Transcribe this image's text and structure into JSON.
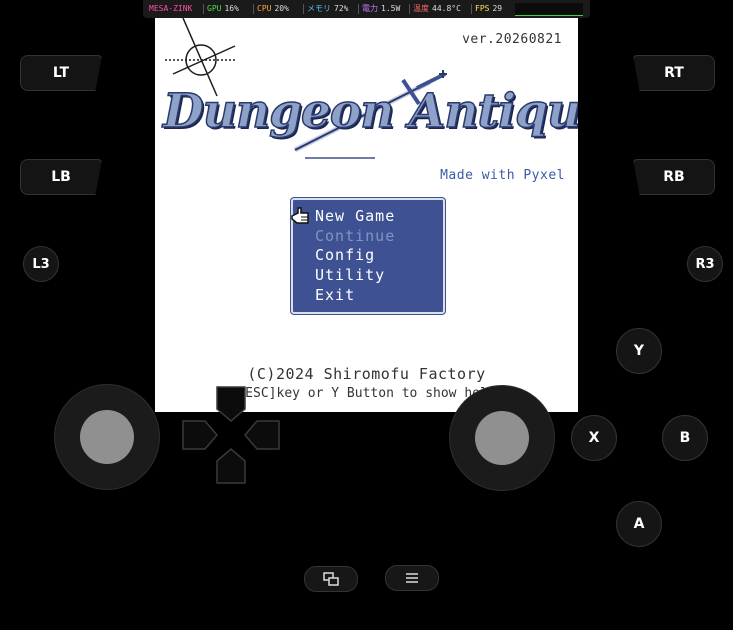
{
  "hud": {
    "renderer": "MESA-ZINK",
    "gpu_label": "GPU",
    "gpu_value": "16%",
    "cpu_label": "CPU",
    "cpu_value": "20%",
    "mem_label": "メモリ",
    "mem_value": "72%",
    "power_label": "電力",
    "power_value": "1.5W",
    "temp_label": "温度",
    "temp_value": "44.8°C",
    "fps_label": "FPS",
    "fps_value": "29",
    "colors": {
      "renderer": "#ff4fa0",
      "gpu": "#4fdc4f",
      "cpu": "#ffa53a",
      "mem": "#4fc3f7",
      "power": "#c37dff",
      "temp": "#ff6b6b",
      "fps": "#ffe14f"
    }
  },
  "game": {
    "version": "ver.20260821",
    "logo": "Dungeon Antiqua",
    "made_with": "Made with Pyxel",
    "menu": [
      {
        "label": "New Game",
        "enabled": true,
        "selected": true
      },
      {
        "label": "Continue",
        "enabled": false,
        "selected": false
      },
      {
        "label": "Config",
        "enabled": true,
        "selected": false
      },
      {
        "label": "Utility",
        "enabled": true,
        "selected": false
      },
      {
        "label": "Exit",
        "enabled": true,
        "selected": false
      }
    ],
    "copyright": "(C)2024 Shiromofu Factory",
    "help": "[ESC]key or Y Button to show help"
  },
  "controls": {
    "lt": "LT",
    "rt": "RT",
    "lb": "LB",
    "rb": "RB",
    "l3": "L3",
    "r3": "R3",
    "y": "Y",
    "x": "X",
    "b": "B",
    "a": "A",
    "view_icon": "windows-icon",
    "menu_icon": "menu-icon",
    "dpad_icon": "dpad-icon"
  }
}
